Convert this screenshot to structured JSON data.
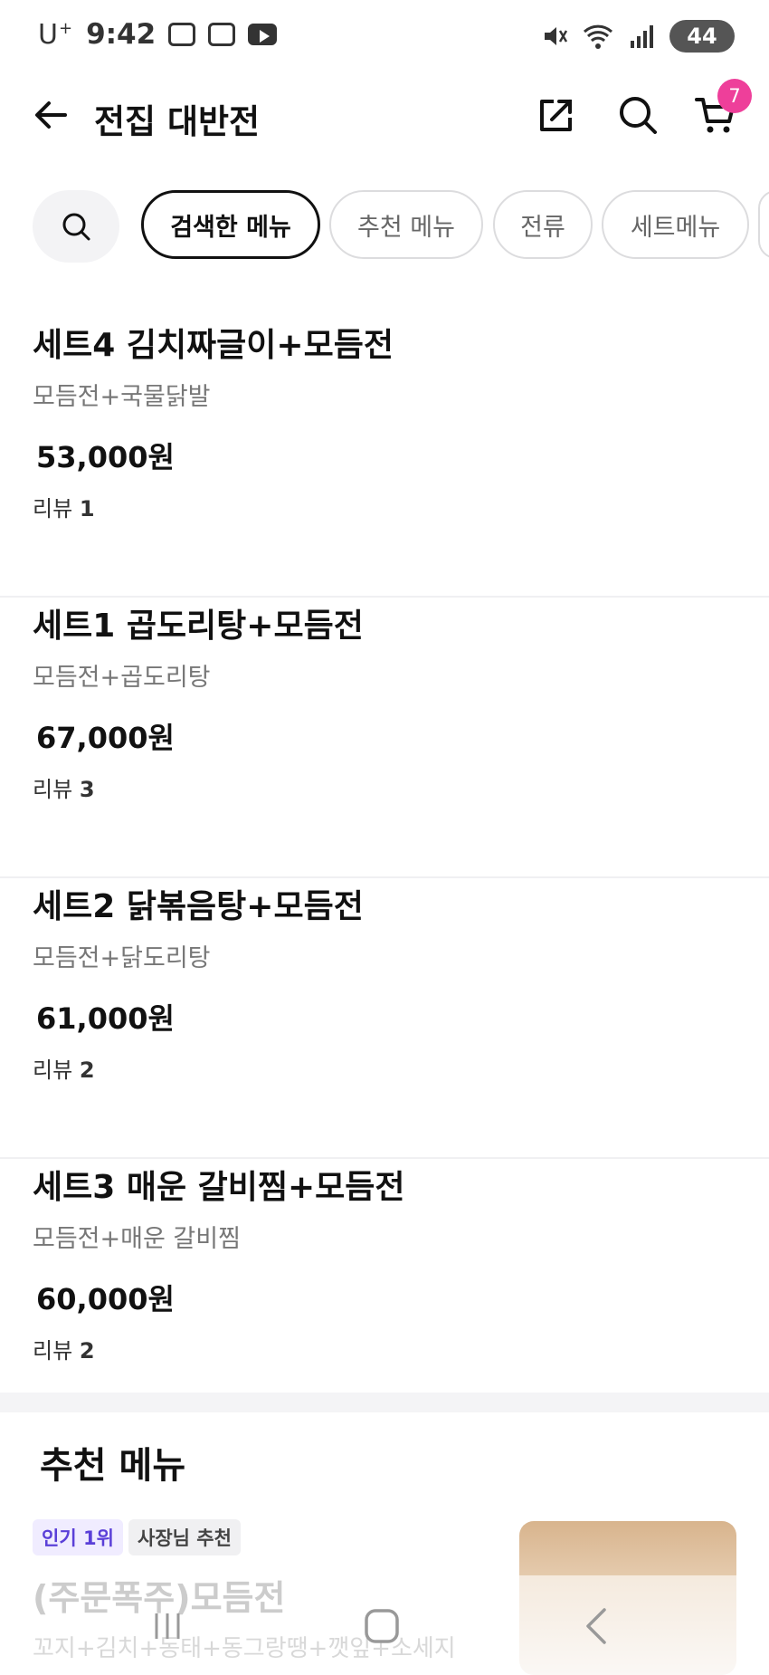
{
  "status_bar": {
    "carrier": "U",
    "carrier_sup": "+",
    "time": "9:42",
    "battery": "44"
  },
  "header": {
    "title": "전집 대반전",
    "cart_count": "7"
  },
  "chips": [
    "검색한 메뉴",
    "추천 메뉴",
    "전류",
    "세트메뉴"
  ],
  "menu_items": [
    {
      "name": "세트4 김치짜글이+모듬전",
      "desc": "모듬전+국물닭발",
      "price": "53,000원",
      "review_label": "리뷰",
      "review_count": "1"
    },
    {
      "name": "세트1 곱도리탕+모듬전",
      "desc": "모듬전+곱도리탕",
      "price": "67,000원",
      "review_label": "리뷰",
      "review_count": "3"
    },
    {
      "name": "세트2 닭볶음탕+모듬전",
      "desc": "모듬전+닭도리탕",
      "price": "61,000원",
      "review_label": "리뷰",
      "review_count": "2"
    },
    {
      "name": "세트3 매운 갈비찜+모듬전",
      "desc": "모듬전+매운 갈비찜",
      "price": "60,000원",
      "review_label": "리뷰",
      "review_count": "2"
    }
  ],
  "recommended": {
    "section_title": "추천 메뉴",
    "badge_popular": "인기 1위",
    "badge_owner": "사장님 추천",
    "name": "(주문폭주)모듬전",
    "desc": "꼬지+김치+동태+동그랑땡+깻잎+소세지"
  },
  "colors": {
    "accent_badge": "#ee3f9a",
    "popular_badge_text": "#5a3fd8"
  }
}
